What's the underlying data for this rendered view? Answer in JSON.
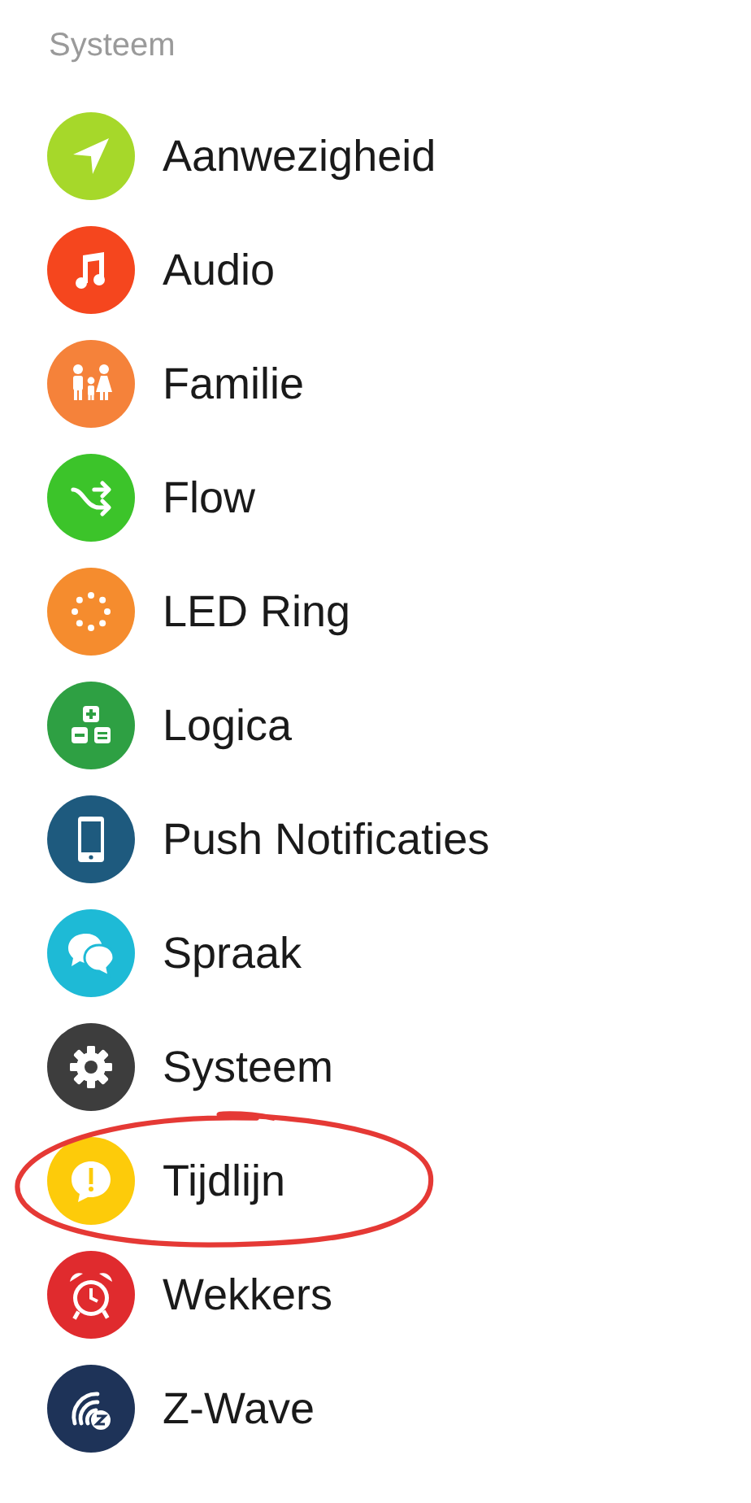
{
  "section_title": "Systeem",
  "items": [
    {
      "label": "Aanwezigheid",
      "color": "#a6d82a",
      "kind": "location",
      "circled": false
    },
    {
      "label": "Audio",
      "color": "#f5461e",
      "kind": "music",
      "circled": false
    },
    {
      "label": "Familie",
      "color": "#f5823a",
      "kind": "family",
      "circled": false
    },
    {
      "label": "Flow",
      "color": "#3cc42a",
      "kind": "shuffle",
      "circled": false
    },
    {
      "label": "LED Ring",
      "color": "#f58c2e",
      "kind": "ring",
      "circled": false
    },
    {
      "label": "Logica",
      "color": "#2ea043",
      "kind": "calculator",
      "circled": false
    },
    {
      "label": "Push Notificaties",
      "color": "#1e5a7e",
      "kind": "phone",
      "circled": false
    },
    {
      "label": "Spraak",
      "color": "#1ebad6",
      "kind": "chat",
      "circled": false
    },
    {
      "label": "Systeem",
      "color": "#3d3d3d",
      "kind": "gear",
      "circled": false
    },
    {
      "label": "Tijdlijn",
      "color": "#fdcb0a",
      "kind": "alert",
      "circled": true
    },
    {
      "label": "Wekkers",
      "color": "#e02b2e",
      "kind": "alarm",
      "circled": false
    },
    {
      "label": "Z-Wave",
      "color": "#1e3358",
      "kind": "zwave",
      "circled": false
    }
  ]
}
